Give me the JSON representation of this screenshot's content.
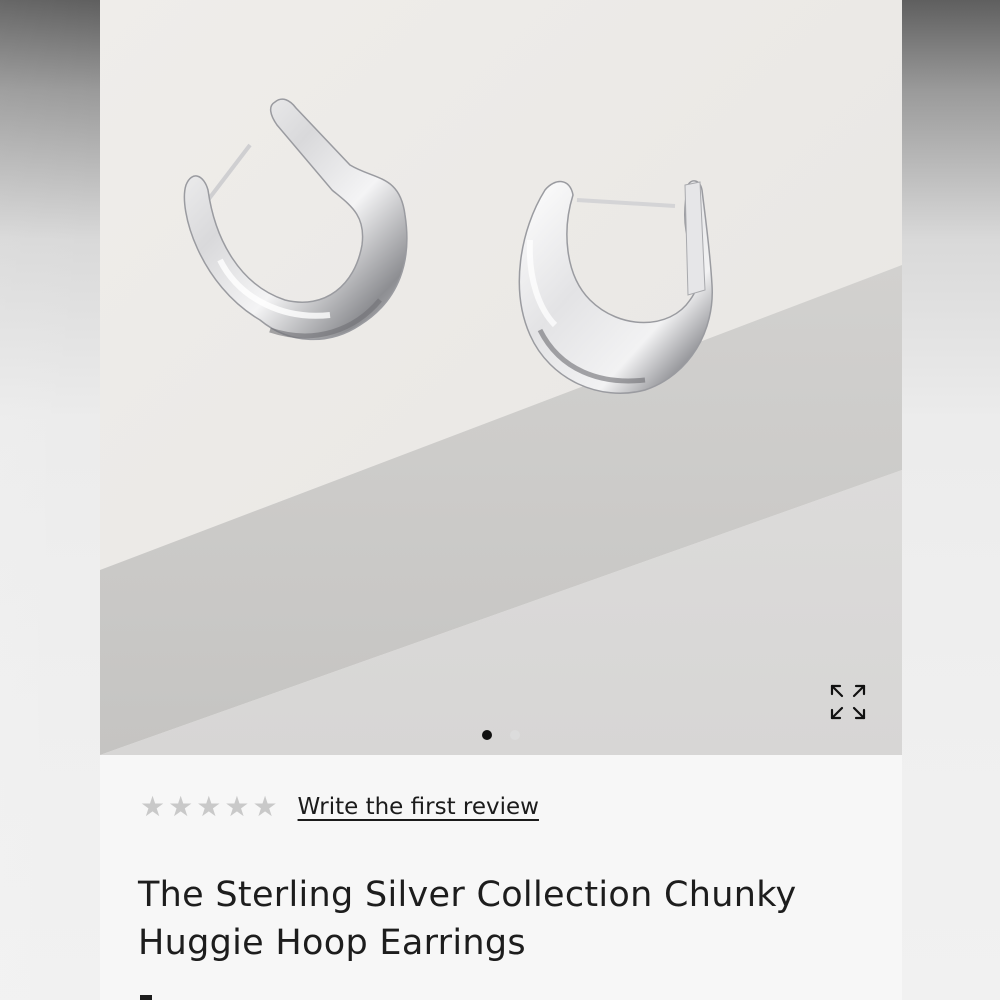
{
  "product": {
    "title": "The Sterling Silver Collection Chunky Huggie Hoop Earrings",
    "image_alt": "Sterling silver chunky huggie hoop earrings"
  },
  "gallery": {
    "expand_icon": "expand-arrows-icon",
    "current_slide": 1,
    "total_slides": 2
  },
  "reviews": {
    "rating": 0,
    "max_rating": 5,
    "star_glyph": "★",
    "write_review_label": "Write the first review"
  },
  "colors": {
    "star_empty": "#c9c9c9",
    "text": "#1d1d1d",
    "dot_active": "#111111",
    "dot_inactive": "#dcdcdc"
  }
}
